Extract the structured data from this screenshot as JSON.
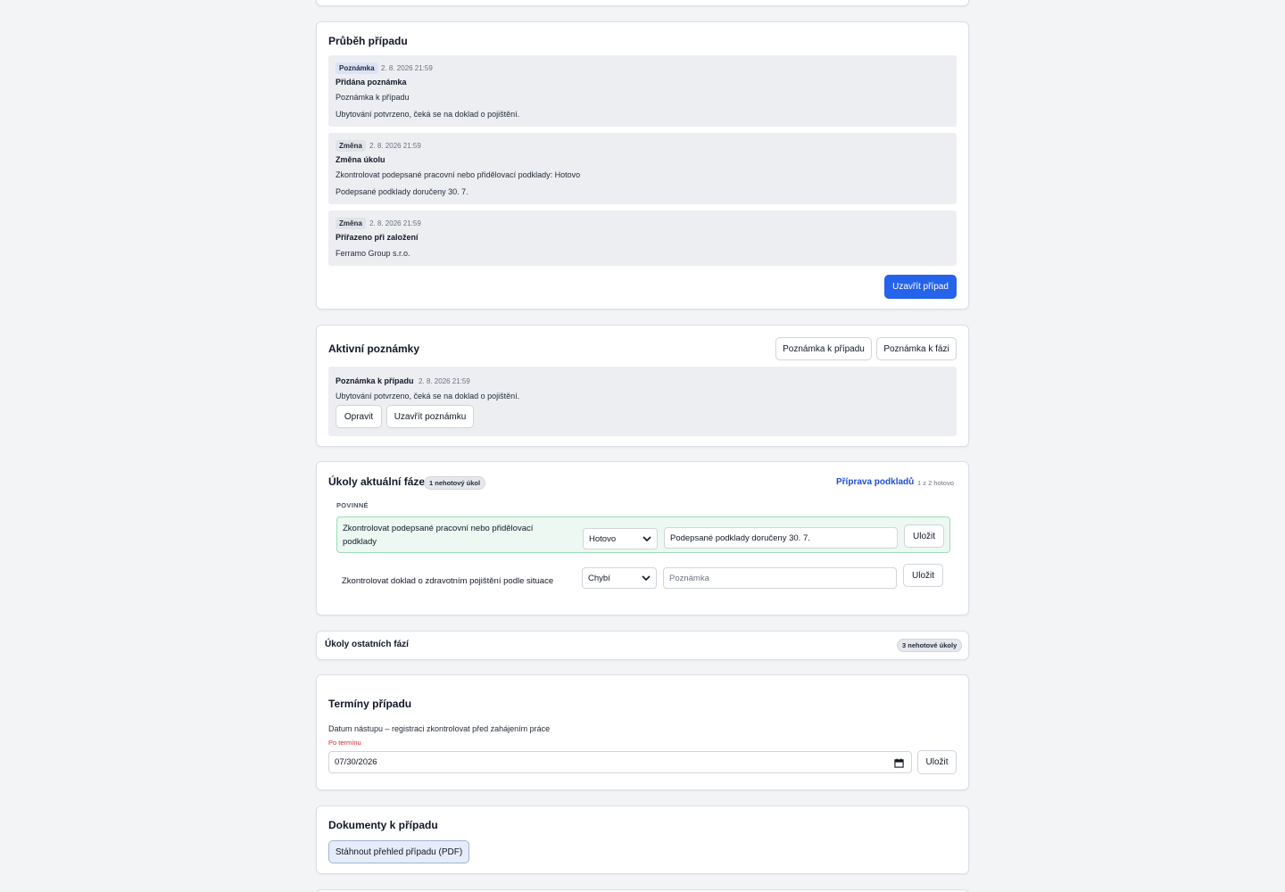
{
  "timeline": {
    "title": "Průběh případu",
    "items": [
      {
        "badge": "Poznámka",
        "timestamp": "2. 8. 2026 21:59",
        "heading": "Přidána poznámka",
        "line1": "Poznámka k případu",
        "line2": "Ubytování potvrzeno, čeká se na doklad o pojištění."
      },
      {
        "badge": "Změna",
        "timestamp": "2. 8. 2026 21:59",
        "heading": "Změna úkolu",
        "line1": "Zkontrolovat podepsané pracovní nebo přidělovací podklady: Hotovo",
        "line2": "Podepsané podklady doručeny 30. 7."
      },
      {
        "badge": "Změna",
        "timestamp": "2. 8. 2026 21:59",
        "heading": "Přiřazeno při založení",
        "line1": "Ferramo Group s.r.o."
      }
    ],
    "close_case_label": "Uzavřít případ"
  },
  "notes": {
    "title": "Aktivní poznámky",
    "case_note_button": "Poznámka k případu",
    "phase_note_button": "Poznámka k fázi",
    "active": {
      "heading": "Poznámka k případu",
      "timestamp": "2. 8. 2026 21:59",
      "text": "Ubytování potvrzeno, čeká se na doklad o pojištění.",
      "edit_label": "Opravit",
      "close_label": "Uzavřít poznámku"
    }
  },
  "current_tasks": {
    "title": "Úkoly aktuální fáze",
    "badge": "1 nehotový úkol",
    "phase_link": "Příprava podkladů",
    "progress": "1 z 2 hotovo",
    "section_label": "POVINNÉ",
    "tasks": [
      {
        "label_line1": "Zkontrolovat podepsané pracovní nebo přidělovací",
        "label_line2": "podklady",
        "status": "Hotovo",
        "note_value": "Podepsané podklady doručeny 30. 7.",
        "note_placeholder": "Poznámka",
        "save_label": "Uložit",
        "done": true
      },
      {
        "label_line1": "Zkontrolovat doklad o zdravotním pojištění podle situace",
        "label_line2": "",
        "status": "Chybí",
        "note_value": "",
        "note_placeholder": "Poznámka",
        "save_label": "Uložit",
        "done": false
      }
    ]
  },
  "other_tasks": {
    "title": "Úkoly ostatních fází",
    "badge": "3 nehotové úkoly"
  },
  "deadlines": {
    "title": "Termíny případu",
    "item_label": "Datum nástupu – registraci zkontrolovat před zahájením práce",
    "overdue_label": "Po termínu",
    "date_value": "07/30/2026",
    "save_label": "Uložit"
  },
  "documents": {
    "title": "Dokumenty k případu",
    "download_label": "Stáhnout přehled případu (PDF)"
  },
  "colors": {
    "primary": "#2563eb",
    "link": "#1d4ed8",
    "overdue": "#dc2626",
    "done_row_bg": "#ecf8f1",
    "done_row_border": "#9fdcb7"
  }
}
